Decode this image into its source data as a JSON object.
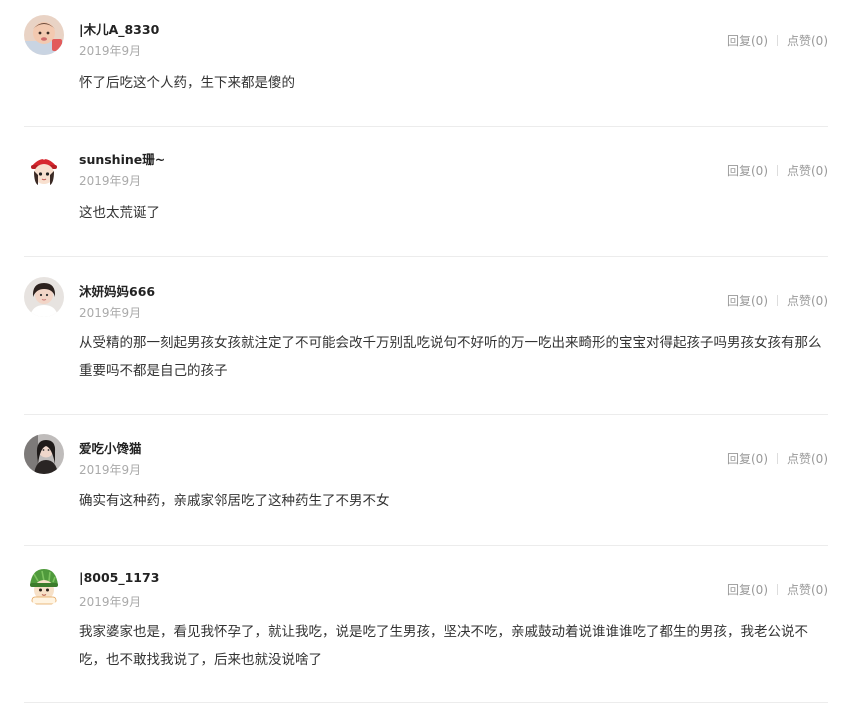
{
  "comments": [
    {
      "username": "|木儿A_8330",
      "date": "2019年9月",
      "text": "怀了后吃这个人药，生下来都是傻的",
      "reply_label": "回复(0)",
      "like_label": "点赞(0)",
      "avatar_icon": "baby-photo-avatar"
    },
    {
      "username": "sunshine珊~",
      "date": "2019年9月",
      "text": "这也太荒诞了",
      "reply_label": "回复(0)",
      "like_label": "点赞(0)",
      "avatar_icon": "cartoon-girl-red-hat-avatar"
    },
    {
      "username": "沐妍妈妈666",
      "date": "2019年9月",
      "text": "从受精的那一刻起男孩女孩就注定了不可能会改千万别乱吃说句不好听的万一吃出来畸形的宝宝对得起孩子吗男孩女孩有那么重要吗不都是自己的孩子",
      "reply_label": "回复(0)",
      "like_label": "点赞(0)",
      "avatar_icon": "woman-photo-avatar"
    },
    {
      "username": "爱吃小馋猫",
      "date": "2019年9月",
      "text": "确实有这种药，亲戚家邻居吃了这种药生了不男不女",
      "reply_label": "回复(0)",
      "like_label": "点赞(0)",
      "avatar_icon": "woman-dark-photo-avatar"
    },
    {
      "username": "|8005_1173",
      "date": "2019年9月",
      "text": "我家婆家也是，看见我怀孕了，就让我吃，说是吃了生男孩，坚决不吃，亲戚鼓动着说谁谁谁吃了都生的男孩，我老公说不吃，也不敢找我说了，后来也就没说啥了",
      "reply_label": "回复(0)",
      "like_label": "点赞(0)",
      "avatar_icon": "cartoon-green-hat-avatar"
    }
  ]
}
